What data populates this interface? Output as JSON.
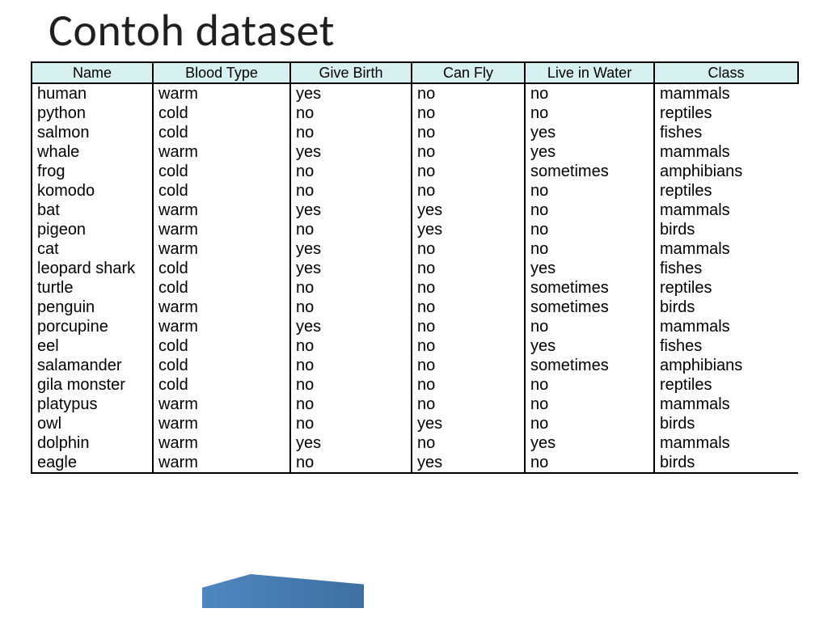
{
  "title": "Contoh dataset",
  "columns": [
    "Name",
    "Blood Type",
    "Give Birth",
    "Can Fly",
    "Live in Water",
    "Class"
  ],
  "rows": [
    {
      "name": "human",
      "blood": "warm",
      "birth": "yes",
      "fly": "no",
      "water": "no",
      "class": "mammals"
    },
    {
      "name": "python",
      "blood": "cold",
      "birth": "no",
      "fly": "no",
      "water": "no",
      "class": "reptiles"
    },
    {
      "name": "salmon",
      "blood": "cold",
      "birth": "no",
      "fly": "no",
      "water": "yes",
      "class": "fishes"
    },
    {
      "name": "whale",
      "blood": "warm",
      "birth": "yes",
      "fly": "no",
      "water": "yes",
      "class": "mammals"
    },
    {
      "name": "frog",
      "blood": "cold",
      "birth": "no",
      "fly": "no",
      "water": "sometimes",
      "class": "amphibians"
    },
    {
      "name": "komodo",
      "blood": "cold",
      "birth": "no",
      "fly": "no",
      "water": "no",
      "class": "reptiles"
    },
    {
      "name": "bat",
      "blood": "warm",
      "birth": "yes",
      "fly": "yes",
      "water": "no",
      "class": "mammals"
    },
    {
      "name": "pigeon",
      "blood": "warm",
      "birth": "no",
      "fly": "yes",
      "water": "no",
      "class": "birds"
    },
    {
      "name": "cat",
      "blood": "warm",
      "birth": "yes",
      "fly": "no",
      "water": "no",
      "class": "mammals"
    },
    {
      "name": "leopard shark",
      "blood": "cold",
      "birth": "yes",
      "fly": "no",
      "water": "yes",
      "class": "fishes"
    },
    {
      "name": "turtle",
      "blood": "cold",
      "birth": "no",
      "fly": "no",
      "water": "sometimes",
      "class": "reptiles"
    },
    {
      "name": "penguin",
      "blood": "warm",
      "birth": "no",
      "fly": "no",
      "water": "sometimes",
      "class": "birds"
    },
    {
      "name": "porcupine",
      "blood": "warm",
      "birth": "yes",
      "fly": "no",
      "water": "no",
      "class": "mammals"
    },
    {
      "name": "eel",
      "blood": "cold",
      "birth": "no",
      "fly": "no",
      "water": "yes",
      "class": "fishes"
    },
    {
      "name": "salamander",
      "blood": "cold",
      "birth": "no",
      "fly": "no",
      "water": "sometimes",
      "class": "amphibians"
    },
    {
      "name": "gila monster",
      "blood": "cold",
      "birth": "no",
      "fly": "no",
      "water": "no",
      "class": "reptiles"
    },
    {
      "name": "platypus",
      "blood": "warm",
      "birth": "no",
      "fly": "no",
      "water": "no",
      "class": "mammals"
    },
    {
      "name": "owl",
      "blood": "warm",
      "birth": "no",
      "fly": "yes",
      "water": "no",
      "class": "birds"
    },
    {
      "name": "dolphin",
      "blood": "warm",
      "birth": "yes",
      "fly": "no",
      "water": "yes",
      "class": "mammals"
    },
    {
      "name": "eagle",
      "blood": "warm",
      "birth": "no",
      "fly": "yes",
      "water": "no",
      "class": "birds"
    }
  ],
  "chart_data": {
    "type": "table",
    "title": "Contoh dataset",
    "columns": [
      "Name",
      "Blood Type",
      "Give Birth",
      "Can Fly",
      "Live in Water",
      "Class"
    ],
    "data": [
      [
        "human",
        "warm",
        "yes",
        "no",
        "no",
        "mammals"
      ],
      [
        "python",
        "cold",
        "no",
        "no",
        "no",
        "reptiles"
      ],
      [
        "salmon",
        "cold",
        "no",
        "no",
        "yes",
        "fishes"
      ],
      [
        "whale",
        "warm",
        "yes",
        "no",
        "yes",
        "mammals"
      ],
      [
        "frog",
        "cold",
        "no",
        "no",
        "sometimes",
        "amphibians"
      ],
      [
        "komodo",
        "cold",
        "no",
        "no",
        "no",
        "reptiles"
      ],
      [
        "bat",
        "warm",
        "yes",
        "yes",
        "no",
        "mammals"
      ],
      [
        "pigeon",
        "warm",
        "no",
        "yes",
        "no",
        "birds"
      ],
      [
        "cat",
        "warm",
        "yes",
        "no",
        "no",
        "mammals"
      ],
      [
        "leopard shark",
        "cold",
        "yes",
        "no",
        "yes",
        "fishes"
      ],
      [
        "turtle",
        "cold",
        "no",
        "no",
        "sometimes",
        "reptiles"
      ],
      [
        "penguin",
        "warm",
        "no",
        "no",
        "sometimes",
        "birds"
      ],
      [
        "porcupine",
        "warm",
        "yes",
        "no",
        "no",
        "mammals"
      ],
      [
        "eel",
        "cold",
        "no",
        "no",
        "yes",
        "fishes"
      ],
      [
        "salamander",
        "cold",
        "no",
        "no",
        "sometimes",
        "amphibians"
      ],
      [
        "gila monster",
        "cold",
        "no",
        "no",
        "no",
        "reptiles"
      ],
      [
        "platypus",
        "warm",
        "no",
        "no",
        "no",
        "mammals"
      ],
      [
        "owl",
        "warm",
        "no",
        "yes",
        "no",
        "birds"
      ],
      [
        "dolphin",
        "warm",
        "yes",
        "no",
        "yes",
        "mammals"
      ],
      [
        "eagle",
        "warm",
        "no",
        "yes",
        "no",
        "birds"
      ]
    ]
  }
}
